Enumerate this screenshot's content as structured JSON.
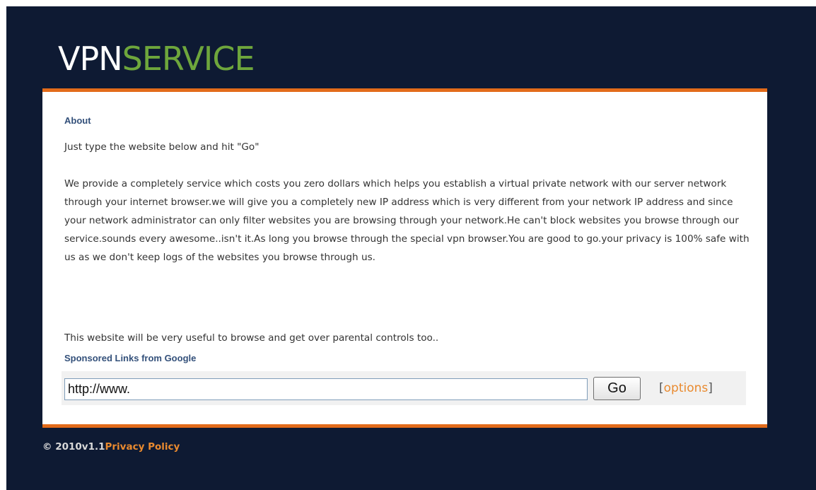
{
  "header": {
    "logo_part1": "VPN",
    "logo_part2": "SERVICE"
  },
  "about": {
    "heading": "About",
    "intro": "Just type the website below and hit \"Go\"",
    "description": "We provide a completely service which costs you zero dollars which helps you establish a virtual private network with our server network through your internet browser.we will give you a completely new IP address which is very different from your network IP address and since your network administrator can only filter websites you are browsing through your network.He can't block websites you browse through our service.sounds every awesome..isn't it.As long you browse through the special vpn browser.You are good to go.your privacy is 100% safe with us as we don't keep logs of the websites you browse through us.",
    "useful": "This website will be very useful to browse and get over parental controls too.."
  },
  "sponsored": {
    "label": "Sponsored Links from Google"
  },
  "form": {
    "url_value": "http://www.",
    "go_label": "Go",
    "options_open": "[",
    "options_label": "options",
    "options_close": "]"
  },
  "footer": {
    "copyright": "© 2010v1.1",
    "privacy_label": "Privacy Policy"
  },
  "colors": {
    "background": "#0e1a33",
    "accent_orange": "#e26b1a",
    "logo_green": "#6ea63c",
    "heading_blue": "#33507a"
  }
}
